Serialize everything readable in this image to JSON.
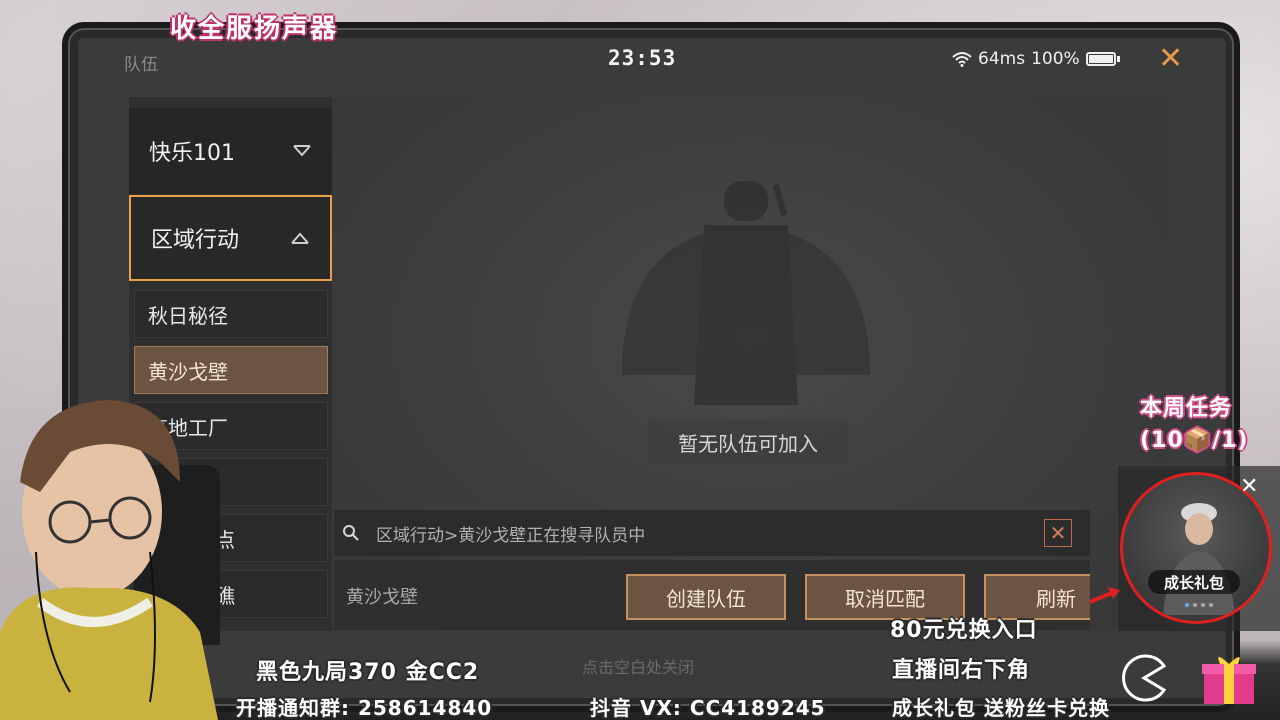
{
  "overlay": {
    "title": "收全服扬声器",
    "weekly_task_title": "本周任务",
    "weekly_task_count": "(10📦/1)",
    "promo_line1": "80元兑换入口",
    "promo_line2": "直播间右下角",
    "left_line": "黑色九局370  金CC2",
    "bottom_line_left": "开播通知群: 258614840",
    "bottom_line_mid": "抖音 VX: CC4189245",
    "bottom_line_right": "成长礼包 送粉丝卡兑换"
  },
  "status_bar": {
    "screen_title": "队伍",
    "time": "23:53",
    "ping": "64ms",
    "battery": "100%"
  },
  "sidebar": {
    "mode_dropdown": "快乐101",
    "category_dropdown": "区域行动",
    "maps": [
      "秋日秘径",
      "黄沙戈壁",
      "高地工厂",
      "",
      "点",
      "礁"
    ],
    "selected_map_index": 1
  },
  "main": {
    "empty_message": "暂无队伍可加入",
    "search_status": "区域行动>黄沙戈壁正在搜寻队员中",
    "current_map_label": "黄沙戈壁",
    "buttons": {
      "create": "创建队伍",
      "cancel_match": "取消匹配",
      "refresh": "刷新"
    },
    "close_hint": "点击空白处关闭"
  },
  "gift_widget": {
    "label": "成长礼包",
    "close": "✕"
  },
  "colors": {
    "accent_orange": "#e8a046",
    "selected_item": "#6b5441",
    "button_border": "#c5915e",
    "gift_ring": "#e02020"
  },
  "icons": [
    "wifi-icon",
    "battery-icon",
    "close-icon",
    "chevron-down-icon",
    "chevron-up-icon",
    "search-icon",
    "gift-box-icon",
    "pac-man-icon"
  ]
}
